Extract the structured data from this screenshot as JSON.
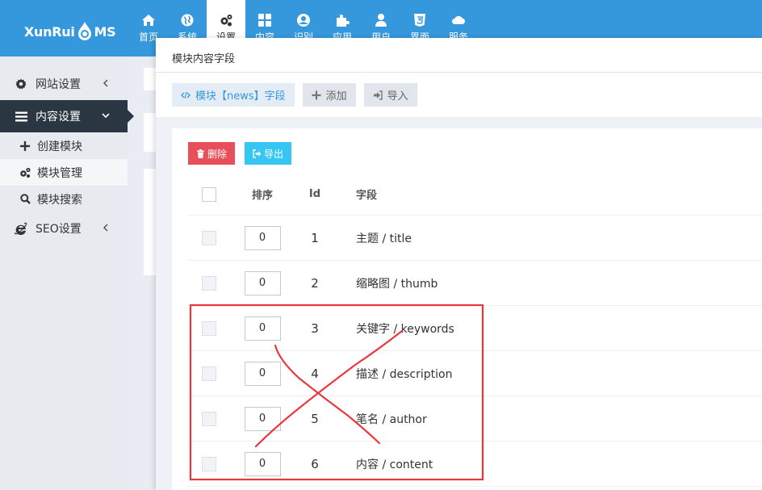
{
  "brand": {
    "logo_text_left": "XunRui",
    "logo_text_right": "MS"
  },
  "nav": [
    {
      "label": "首页",
      "icon": "home-icon"
    },
    {
      "label": "系统",
      "icon": "globe-icon"
    },
    {
      "label": "设置",
      "icon": "cogs-icon",
      "active": true
    },
    {
      "label": "内容",
      "icon": "grid-icon"
    },
    {
      "label": "识别",
      "icon": "user-circle-icon"
    },
    {
      "label": "应用",
      "icon": "puzzle-icon"
    },
    {
      "label": "用户",
      "icon": "user-icon"
    },
    {
      "label": "界面",
      "icon": "html5-icon"
    },
    {
      "label": "服务",
      "icon": "cloud-icon"
    }
  ],
  "sidebar": {
    "items": [
      {
        "label": "网站设置",
        "icon": "gear-icon"
      },
      {
        "label": "内容设置",
        "icon": "bars-icon",
        "active": true
      },
      {
        "label": "SEO设置",
        "icon": "ie-icon"
      }
    ],
    "sub": [
      {
        "label": "创建模块",
        "icon": "plus-icon"
      },
      {
        "label": "模块管理",
        "icon": "cogs-icon",
        "selected": true
      },
      {
        "label": "模块搜索",
        "icon": "search-icon"
      }
    ]
  },
  "dialog": {
    "title": "模块内容字段",
    "toolbar": {
      "module_label": "模块【news】字段",
      "add_label": "添加",
      "import_label": "导入"
    },
    "actions": {
      "delete_label": "删除",
      "export_label": "导出"
    },
    "table": {
      "headers": {
        "order": "排序",
        "id": "Id",
        "field": "字段"
      },
      "rows": [
        {
          "order": "0",
          "id": "1",
          "field": "主题 / title"
        },
        {
          "order": "0",
          "id": "2",
          "field": "缩略图 / thumb"
        },
        {
          "order": "0",
          "id": "3",
          "field": "关键字 / keywords"
        },
        {
          "order": "0",
          "id": "4",
          "field": "描述 / description"
        },
        {
          "order": "0",
          "id": "5",
          "field": "笔名 / author"
        },
        {
          "order": "0",
          "id": "6",
          "field": "内容 / content"
        }
      ]
    }
  },
  "colors": {
    "topbar": "#3598dc",
    "sidebar_active": "#2b3643",
    "delete_button": "#e7505a",
    "export_button": "#36c6f4",
    "annotation": "#e8383d"
  }
}
